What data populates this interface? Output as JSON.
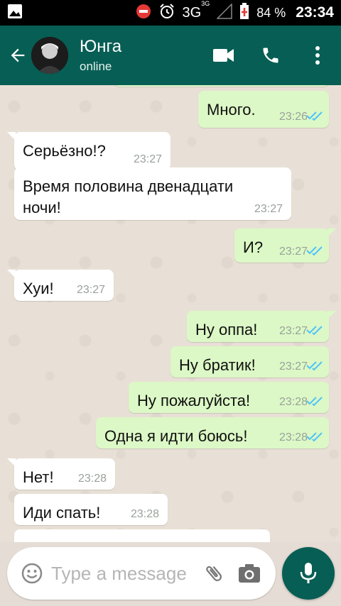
{
  "status_bar": {
    "network": "3G",
    "network_sup": "3G",
    "battery": "84 %",
    "time": "23:34"
  },
  "header": {
    "contact_name": "Юнга",
    "contact_status": "online",
    "icons": [
      "back-arrow-icon",
      "video-call-icon",
      "phone-icon",
      "more-vert-icon"
    ],
    "color": "#075e54"
  },
  "messages": [
    {
      "dir": "out",
      "text": "",
      "time": "",
      "partial": true
    },
    {
      "dir": "out",
      "text": "Много.",
      "time": "23:26",
      "read": true
    },
    {
      "dir": "in",
      "text": "Серьёзно!?",
      "time": "23:27"
    },
    {
      "dir": "in",
      "text": "Время половина двенадцати ночи!",
      "time": "23:27"
    },
    {
      "dir": "out",
      "text": "И?",
      "time": "23:27",
      "read": true
    },
    {
      "dir": "in",
      "text": "Хуи!",
      "time": "23:27"
    },
    {
      "dir": "out",
      "text": "Ну оппа!",
      "time": "23:27",
      "read": true
    },
    {
      "dir": "out",
      "text": "Ну братик!",
      "time": "23:27",
      "read": true
    },
    {
      "dir": "out",
      "text": "Ну пожалуйста!",
      "time": "23:28",
      "read": true
    },
    {
      "dir": "out",
      "text": "Одна я идти боюсь!",
      "time": "23:28",
      "read": true
    },
    {
      "dir": "in",
      "text": "Нет!",
      "time": "23:28"
    },
    {
      "dir": "in",
      "text": "Иди спать!",
      "time": "23:28"
    },
    {
      "dir": "in",
      "text": "",
      "time": "",
      "partial": true
    }
  ],
  "composer": {
    "placeholder": "Type a message",
    "icons": [
      "emoji-icon",
      "attach-icon",
      "camera-icon",
      "mic-icon"
    ]
  },
  "colors": {
    "incoming": "#ffffff",
    "outgoing": "#dcf8c6",
    "read_tick": "#4fc3f7",
    "chat_bg": "#e5ddd5"
  }
}
